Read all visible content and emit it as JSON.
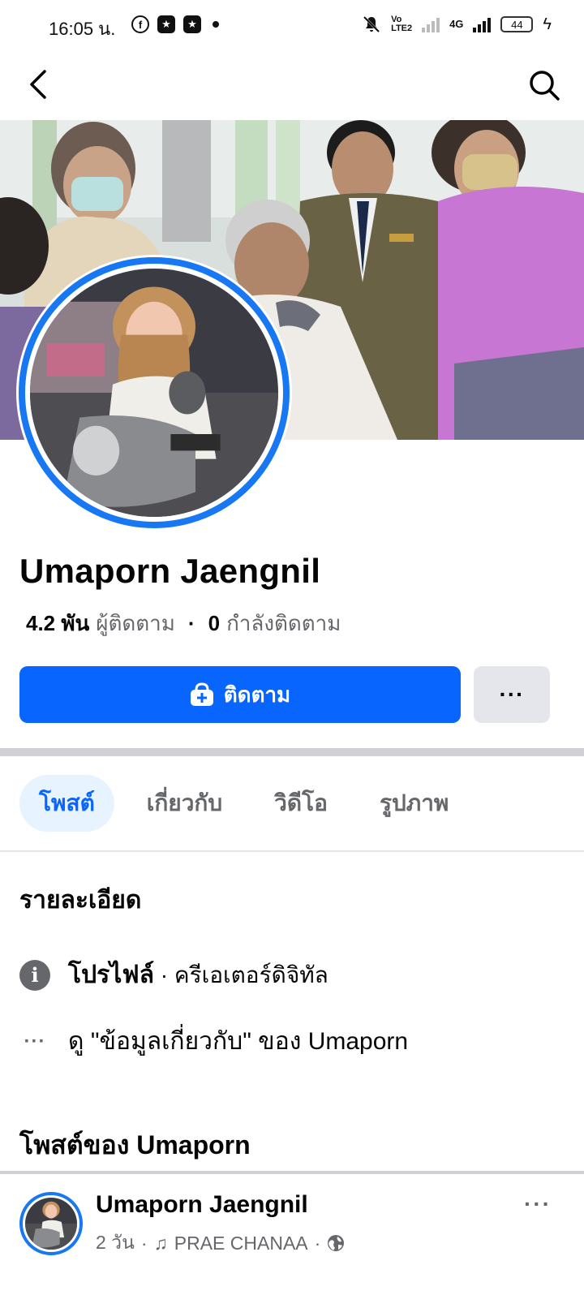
{
  "status_bar": {
    "time": "16:05 น.",
    "battery": "44",
    "network_label": "4G",
    "volte_label": "Vo LTE2"
  },
  "nav": {
    "back_icon": "chevron-left-icon",
    "search_icon": "search-icon"
  },
  "profile": {
    "name": "Umaporn Jaengnil",
    "followers_count": "4.2 พัน",
    "followers_label": "ผู้ติดตาม",
    "following_count": "0",
    "following_label": "กำลังติดตาม"
  },
  "actions": {
    "follow_label": "ติดตาม",
    "more_label": "···"
  },
  "tabs": [
    {
      "label": "โพสต์",
      "active": true
    },
    {
      "label": "เกี่ยวกับ",
      "active": false
    },
    {
      "label": "วิดีโอ",
      "active": false
    },
    {
      "label": "รูปภาพ",
      "active": false
    }
  ],
  "details": {
    "title": "รายละเอียด",
    "profile_type_bold": "โปรไฟล์",
    "profile_type_rest": " · ครีเอเตอร์ดิจิทัล",
    "about_link": "ดู \"ข้อมูลเกี่ยวกับ\" ของ Umaporn"
  },
  "posts": {
    "title": "โพสต์ของ Umaporn",
    "items": [
      {
        "author": "Umaporn Jaengnil",
        "time": "2 วัน",
        "music": "PRAE CHANAA",
        "more": "···"
      }
    ]
  },
  "colors": {
    "brand_blue": "#0866ff",
    "ring_blue": "#1877f2",
    "muted": "#65676b"
  }
}
